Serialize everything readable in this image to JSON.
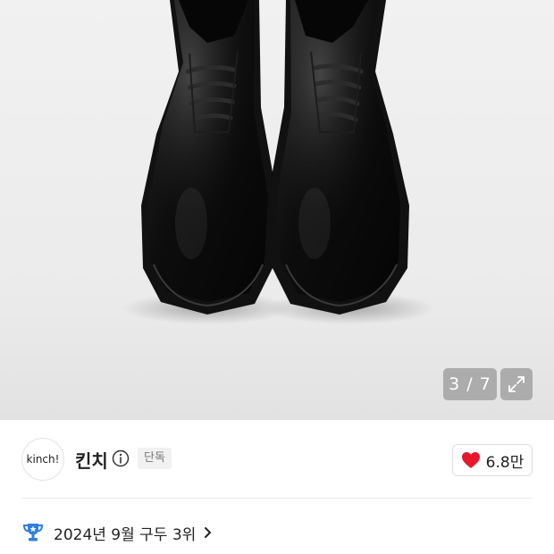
{
  "gallery": {
    "current": 3,
    "total": 7,
    "counter_text": "3 / 7",
    "expand_icon": "expand-arrows-icon"
  },
  "brand": {
    "logo_text": "kinch!",
    "name": "킨치",
    "info_icon": "info-circle-icon",
    "exclusive_badge": "단독"
  },
  "like": {
    "icon": "heart-icon",
    "count": "6.8만",
    "heart_color": "#e8182b"
  },
  "ranking": {
    "icon": "trophy-icon",
    "text": "2024년 9월 구두 3위",
    "chevron_icon": "chevron-right-icon",
    "trophy_color": "#2f7fe0"
  }
}
